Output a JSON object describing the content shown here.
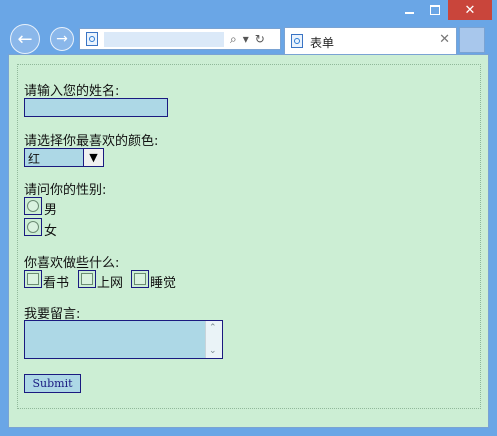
{
  "window": {
    "close_glyph": "✕"
  },
  "nav": {
    "back_glyph": "←",
    "forward_glyph": "→",
    "refresh_glyph": "↻",
    "search_glyph": "⌕",
    "dropdown_glyph": "▾"
  },
  "address": {
    "url": ""
  },
  "tab": {
    "title": "表单",
    "close_glyph": "✕"
  },
  "form": {
    "name_label": "请输入您的姓名:",
    "name_value": "",
    "color_label": "请选择你最喜欢的颜色:",
    "color_selected": "红",
    "gender_label": "请问你的性别:",
    "gender_options": [
      "男",
      "女"
    ],
    "hobby_label": "你喜欢做些什么:",
    "hobby_options": [
      "看书",
      "上网",
      "睡觉"
    ],
    "message_label": "我要留言:",
    "submit_label": "Submit"
  },
  "colors": {
    "titlebar": "#6aa6e6",
    "content_bg": "#cceed4",
    "field_bg": "#add8e6",
    "field_border": "#1a1a80",
    "close_red": "#c9453b"
  },
  "icons": [
    "minimize-icon",
    "maximize-icon",
    "close-icon",
    "back-icon",
    "forward-icon",
    "page-icon",
    "search-icon",
    "refresh-icon",
    "tab-page-icon",
    "tab-close-icon",
    "select-arrow-icon"
  ]
}
